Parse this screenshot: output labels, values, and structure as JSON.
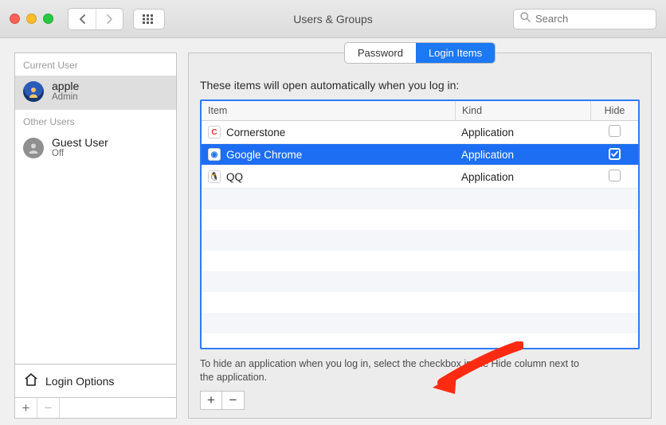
{
  "window": {
    "title": "Users & Groups"
  },
  "search": {
    "placeholder": "Search"
  },
  "sidebar": {
    "current_hdr": "Current User",
    "other_hdr": "Other Users",
    "current": {
      "name": "apple",
      "role": "Admin"
    },
    "other": {
      "name": "Guest User",
      "role": "Off"
    },
    "login_options": "Login Options",
    "add": "+",
    "remove": "−"
  },
  "tabs": {
    "password": "Password",
    "login_items": "Login Items"
  },
  "panel": {
    "instruction": "These items will open automatically when you log in:",
    "columns": {
      "item": "Item",
      "kind": "Kind",
      "hide": "Hide"
    },
    "hint": "To hide an application when you log in, select the checkbox in the Hide column next to the application.",
    "add": "+",
    "remove": "−",
    "rows": [
      {
        "name": "Cornerstone",
        "kind": "Application",
        "hide": false,
        "selected": false,
        "icon": {
          "bg": "#ffffff",
          "fg": "#d8332a",
          "letter": "C",
          "border": "#d0d0d0"
        }
      },
      {
        "name": "Google Chrome",
        "kind": "Application",
        "hide": true,
        "selected": true,
        "icon": {
          "bg": "#ffffff",
          "fg": "#1a73e8",
          "letter": "◉",
          "border": "#d0d0d0"
        }
      },
      {
        "name": "QQ",
        "kind": "Application",
        "hide": false,
        "selected": false,
        "icon": {
          "bg": "#ffffff",
          "fg": "#e3142a",
          "letter": "🐧",
          "border": "#d0d0d0"
        }
      }
    ]
  }
}
